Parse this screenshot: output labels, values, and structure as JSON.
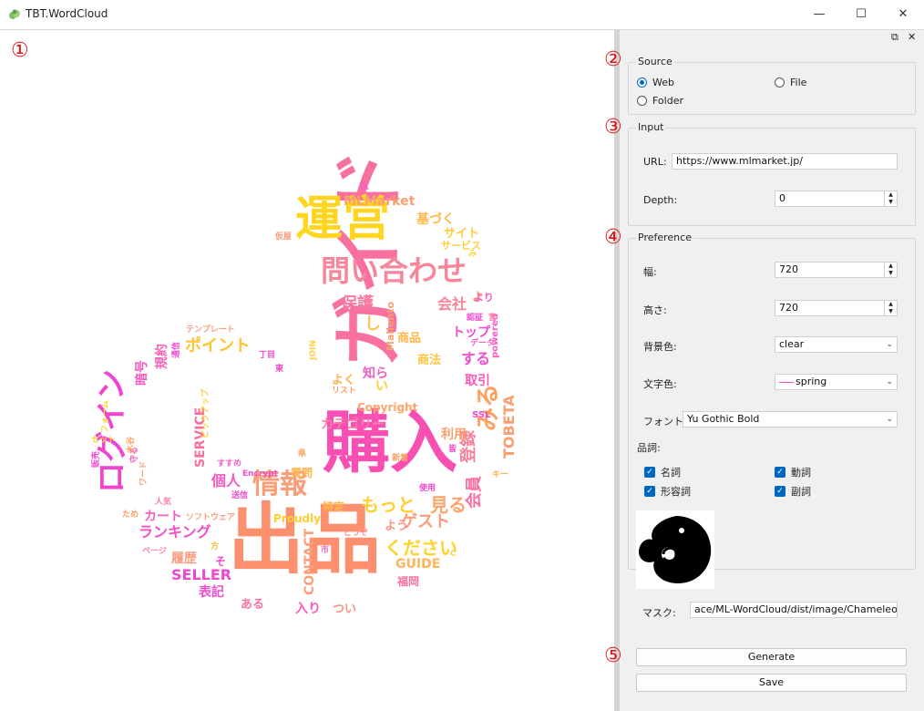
{
  "window": {
    "title": "TBT.WordCloud",
    "minimize": "—",
    "maximize": "☐",
    "close": "✕"
  },
  "markers": {
    "canvas": "①",
    "source": "②",
    "input": "③",
    "preference": "④",
    "actions": "⑤"
  },
  "dock": {
    "float": "⧉",
    "close": "✕"
  },
  "source": {
    "title": "Source",
    "web": "Web",
    "file": "File",
    "folder": "Folder",
    "selected": "web"
  },
  "input": {
    "title": "Input",
    "url_label": "URL:",
    "url_value": "https://www.mlmarket.jp/",
    "depth_label": "Depth:",
    "depth_value": "0"
  },
  "preference": {
    "title": "Preference",
    "width_label": "幅:",
    "width_value": "720",
    "height_label": "高さ:",
    "height_value": "720",
    "bg_label": "背景色:",
    "bg_value": "clear",
    "text_color_label": "文字色:",
    "text_color_value": "spring",
    "font_label": "フォント:",
    "font_value": "Yu Gothic Bold",
    "pos_label": "品詞:",
    "pos": [
      {
        "label": "名詞",
        "checked": true
      },
      {
        "label": "動詞",
        "checked": true
      },
      {
        "label": "形容詞",
        "checked": true
      },
      {
        "label": "副詞",
        "checked": true
      }
    ],
    "mask_label": "マスク:",
    "mask_value": "ace/ML-WordCloud/dist/image/Chameleon.png"
  },
  "actions": {
    "generate": "Generate",
    "save": "Save"
  },
  "wordcloud": {
    "words": [
      {
        "text": "出品",
        "color": "#fb8f6e"
      },
      {
        "text": "購入",
        "color": "#f74fb2"
      },
      {
        "text": "ガイド",
        "color": "#f870a0"
      },
      {
        "text": "運営",
        "color": "#ffd51e"
      },
      {
        "text": "問い合わせ",
        "color": "#f8869a"
      },
      {
        "text": "ログイン",
        "color": "#f044d0"
      },
      {
        "text": "情報",
        "color": "#fb9d76"
      },
      {
        "text": "もっと",
        "color": "#ffd033"
      },
      {
        "text": "見る",
        "color": "#fba46c"
      },
      {
        "text": "会員",
        "color": "#f970a2"
      },
      {
        "text": "登録",
        "color": "#f7819a"
      },
      {
        "text": "TOBETA",
        "color": "#fb9e72"
      },
      {
        "text": "ランキング",
        "color": "#f54ec2"
      },
      {
        "text": "ゲスト",
        "color": "#fc9b7c"
      },
      {
        "text": "ください",
        "color": "#ffd22a"
      },
      {
        "text": "ポイント",
        "color": "#ffc430"
      },
      {
        "text": "みる",
        "color": "#ffa05e"
      },
      {
        "text": "MLMarket",
        "color": "#fb9e70"
      },
      {
        "text": "保護",
        "color": "#f7799e"
      },
      {
        "text": "会社",
        "color": "#f7859a"
      },
      {
        "text": "基づく",
        "color": "#ffb84a"
      },
      {
        "text": "サイト",
        "color": "#ffcc3a"
      },
      {
        "text": "サービス",
        "color": "#ffd040"
      },
      {
        "text": "個人",
        "color": "#f25ac0"
      },
      {
        "text": "カート",
        "color": "#f25ec2"
      },
      {
        "text": "SERVICE",
        "color": "#f8719e"
      },
      {
        "text": "CONTACT",
        "color": "#fb9f7a"
      },
      {
        "text": "GUIDE",
        "color": "#ffb456"
      },
      {
        "text": "SELLER",
        "color": "#f046d2"
      },
      {
        "text": "表記",
        "color": "#f04ccc"
      },
      {
        "text": "履歴",
        "color": "#fc9a80"
      },
      {
        "text": "入り",
        "color": "#f35ac2"
      },
      {
        "text": "つい",
        "color": "#fb9480"
      },
      {
        "text": "ある",
        "color": "#f8729c"
      },
      {
        "text": "福岡",
        "color": "#f871a0"
      },
      {
        "text": "Proudly",
        "color": "#ffce2e"
      },
      {
        "text": "質問",
        "color": "#ffb24e"
      },
      {
        "text": "特定",
        "color": "#ffb84a"
      },
      {
        "text": "よう",
        "color": "#fb9482"
      },
      {
        "text": "カテゴリー",
        "color": "#fa7ca6"
      },
      {
        "text": "Copyright",
        "color": "#ffa464"
      },
      {
        "text": "利用",
        "color": "#f9a26e"
      },
      {
        "text": "商品",
        "color": "#ffb84c"
      },
      {
        "text": "商法",
        "color": "#ffc440"
      },
      {
        "text": "取引",
        "color": "#f75ab8"
      },
      {
        "text": "する",
        "color": "#f04ccc"
      },
      {
        "text": "トップ",
        "color": "#f04ad0"
      },
      {
        "text": "知ら",
        "color": "#f15ec4"
      },
      {
        "text": "い",
        "color": "#ffd02a"
      },
      {
        "text": "よく",
        "color": "#ffb24a"
      },
      {
        "text": "し",
        "color": "#ffc24a"
      },
      {
        "text": "よ",
        "color": "#ffa264"
      },
      {
        "text": "Mallento",
        "color": "#f9a070"
      },
      {
        "text": "powered",
        "color": "#f25ec2"
      },
      {
        "text": "データ",
        "color": "#f062c8"
      },
      {
        "text": "より",
        "color": "#f25ec2"
      },
      {
        "text": "認証",
        "color": "#f04acc"
      },
      {
        "text": "宮",
        "color": "#ff7ab0"
      },
      {
        "text": "み",
        "color": "#ffd040"
      },
      {
        "text": "SSL",
        "color": "#f04acc"
      },
      {
        "text": "キー",
        "color": "#ffb24a"
      },
      {
        "text": "テンプレート",
        "color": "#fb9c7c"
      },
      {
        "text": "規約",
        "color": "#f562ba"
      },
      {
        "text": "暗号",
        "color": "#f25cc0"
      },
      {
        "text": "通信",
        "color": "#f04ad0"
      },
      {
        "text": "人気",
        "color": "#fa82a2"
      },
      {
        "text": "ソフトウェア",
        "color": "#fb9e7a"
      },
      {
        "text": "ページ",
        "color": "#fc8aa8"
      },
      {
        "text": "ため",
        "color": "#f8a070"
      },
      {
        "text": "すすめ",
        "color": "#f062c8"
      },
      {
        "text": "送信",
        "color": "#f04ad0"
      },
      {
        "text": "Encrypt",
        "color": "#f04ccc"
      },
      {
        "text": "リスト",
        "color": "#ffa268"
      },
      {
        "text": "JOIN",
        "color": "#ffd040"
      },
      {
        "text": "丁目",
        "color": "#f04ad0"
      },
      {
        "text": "東",
        "color": "#f04acc"
      },
      {
        "text": "区",
        "color": "#f062c8"
      },
      {
        "text": "仮屋",
        "color": "#fb9c78"
      },
      {
        "text": "フォーム",
        "color": "#ffd22a"
      },
      {
        "text": "セット",
        "color": "#ffd030"
      },
      {
        "text": "新着",
        "color": "#ffa064"
      },
      {
        "text": "使用",
        "color": "#f04acc"
      },
      {
        "text": "県",
        "color": "#ffa064"
      },
      {
        "text": "市",
        "color": "#f06ac0"
      },
      {
        "text": "どうぞ",
        "color": "#fc9082"
      },
      {
        "text": "方",
        "color": "#ffc042"
      },
      {
        "text": "そ",
        "color": "#f04ccc"
      },
      {
        "text": "C",
        "color": "#ffd040"
      },
      {
        "text": "ピックアップ",
        "color": "#ffd040"
      },
      {
        "text": "守る",
        "color": "#f062c8"
      },
      {
        "text": "水谷",
        "color": "#ffa464"
      },
      {
        "text": "販売",
        "color": "#f04ad0"
      },
      {
        "text": "ワード",
        "color": "#fb9e7a"
      },
      {
        "text": "皆",
        "color": "#f04acc"
      }
    ]
  }
}
